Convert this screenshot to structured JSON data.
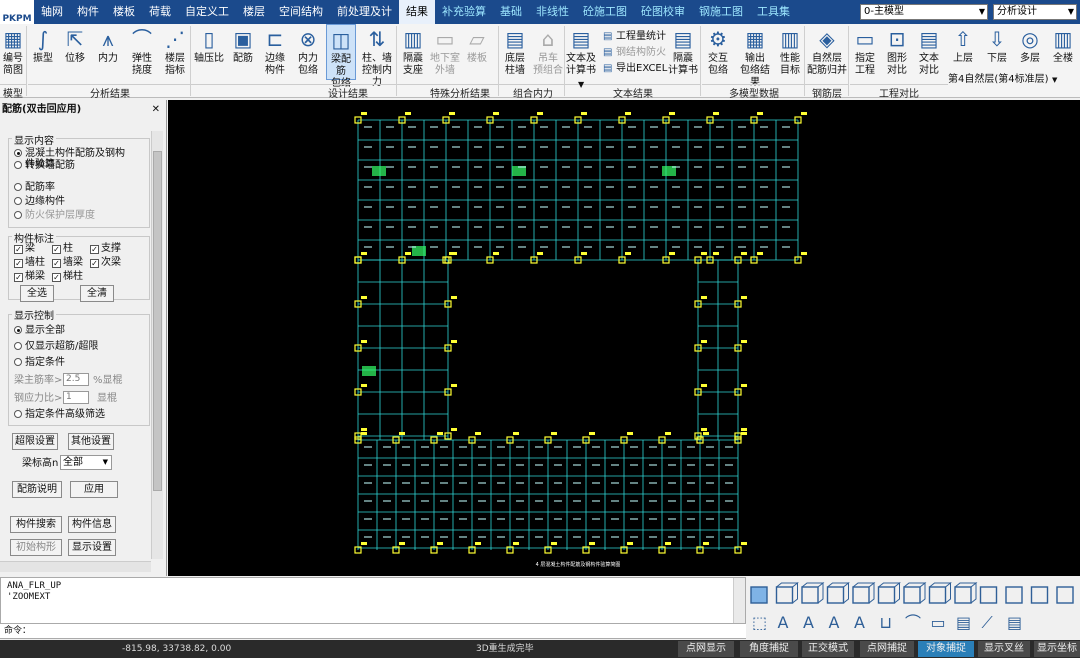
{
  "app": {
    "logo_text": "PKPM"
  },
  "menu": {
    "tabs": [
      "轴网",
      "构件",
      "楼板",
      "荷载",
      "自定义工",
      "楼层",
      "空间结构",
      "前处理及计",
      "结果",
      "补充验算",
      "基础",
      "非线性",
      "砼施工图",
      "砼图校审",
      "钢施工图",
      "工具集"
    ],
    "active": "结果",
    "model_select": "0-主模型",
    "mode_select": "分析设计"
  },
  "ribbon": {
    "buttons": [
      {
        "id": "numbering",
        "label": "编号\n简图"
      },
      {
        "id": "vibration",
        "label": "振型"
      },
      {
        "id": "displacement",
        "label": "位移"
      },
      {
        "id": "internal_force",
        "label": "内力"
      },
      {
        "id": "elastic_deflection",
        "label": "弹性\n挠度"
      },
      {
        "id": "floor_index",
        "label": "楼层\n指标"
      },
      {
        "id": "axial_ratio",
        "label": "轴压比"
      },
      {
        "id": "reinforcement",
        "label": "配筋"
      },
      {
        "id": "edge_member",
        "label": "边缘\n构件"
      },
      {
        "id": "force_envelope",
        "label": "内力\n包络"
      },
      {
        "id": "beam_envelope",
        "label": "梁配筋\n包络"
      },
      {
        "id": "column_wall_control",
        "label": "柱、墙\n控制内力"
      },
      {
        "id": "isolation_support",
        "label": "隔震\n支座"
      },
      {
        "id": "basement_wall",
        "label": "地下室\n外墙"
      },
      {
        "id": "floor_slab",
        "label": "楼板"
      },
      {
        "id": "bottom_column_wall",
        "label": "底层\n柱墙"
      },
      {
        "id": "crane_combination",
        "label": "吊车\n预组合"
      },
      {
        "id": "text_calc",
        "label": "文本及\n计算书"
      },
      {
        "id": "isolation_calc",
        "label": "隔震\n计算书"
      },
      {
        "id": "interaction_envelope",
        "label": "交互\n包络"
      },
      {
        "id": "output_envelope",
        "label": "输出\n包络结果"
      },
      {
        "id": "performance_target",
        "label": "性能\n目标"
      },
      {
        "id": "natural_floor_rebar",
        "label": "自然层\n配筋归并"
      },
      {
        "id": "specify_project",
        "label": "指定\n工程"
      },
      {
        "id": "graphic_compare",
        "label": "图形\n对比"
      },
      {
        "id": "text_compare",
        "label": "文本\n对比"
      },
      {
        "id": "upper_floor",
        "label": "上层"
      },
      {
        "id": "lower_floor",
        "label": "下层"
      },
      {
        "id": "multi_floor",
        "label": "多层"
      },
      {
        "id": "all_floors",
        "label": "全楼"
      }
    ],
    "small_buttons": {
      "quantity_stats": "工程量统计",
      "steel_fireproof": "钢结构防火",
      "export_excel": "导出EXCEL"
    },
    "groups": [
      "模型",
      "分析结果",
      "设计结果",
      "特殊分析结果",
      "组合内力",
      "文本结果",
      "多模型数据",
      "钢筋层",
      "工程对比"
    ],
    "floor_select": "第4自然层(第4标准层)"
  },
  "panel": {
    "title": "配筋(双击回应用)",
    "display_content": {
      "title": "显示内容",
      "options": [
        "混凝土构件配筋及钢构件验算",
        "转换墙配筋",
        "配筋率",
        "边缘构件",
        "防火保护层厚度"
      ],
      "selected": 0
    },
    "member_label": {
      "title": "构件标注",
      "items": [
        {
          "label": "梁",
          "checked": true
        },
        {
          "label": "柱",
          "checked": true
        },
        {
          "label": "支撑",
          "checked": true
        },
        {
          "label": "墙柱",
          "checked": true
        },
        {
          "label": "墙梁",
          "checked": true
        },
        {
          "label": "次梁",
          "checked": true
        },
        {
          "label": "梯梁",
          "checked": true
        },
        {
          "label": "梯柱",
          "checked": true
        }
      ],
      "select_all": "全选",
      "clear_all": "全清"
    },
    "display_control": {
      "title": "显示控制",
      "options": [
        "显示全部",
        "仅显示超筋/超限",
        "指定条件",
        "指定条件高级筛选"
      ],
      "selected": 0,
      "beam_ratio_label": "梁主筋率>",
      "beam_ratio_value": "2.5",
      "beam_ratio_unit": "%显棍",
      "steel_stress_label": "钢应力比>",
      "steel_stress_value": "1",
      "steel_stress_unit": "显棍"
    },
    "buttons": {
      "over_limit": "超限设置",
      "other_settings": "其他设置",
      "rebar_note": "配筋说明",
      "apply": "应用",
      "member_search": "构件搜索",
      "member_info": "构件信息",
      "initial_shape": "初始构形",
      "display_settings": "显示设置"
    },
    "beam_height_label": "梁标高n",
    "beam_height_value": "全部"
  },
  "command": {
    "history": [
      "ANA_FLR_UP",
      "'ZOOMEXT"
    ],
    "prompt": "命令："
  },
  "status": {
    "coords": "-815.98, 33738.82, 0.00",
    "message": "3D重生成完毕",
    "toggles": [
      {
        "label": "点网显示",
        "on": false
      },
      {
        "label": "角度捕捉",
        "on": false
      },
      {
        "label": "正交模式",
        "on": false
      },
      {
        "label": "点网捕捉",
        "on": false
      },
      {
        "label": "对象捕捉",
        "on": true
      },
      {
        "label": "显示叉丝",
        "on": false
      },
      {
        "label": "显示坐标",
        "on": false
      }
    ]
  },
  "colors": {
    "menubar": "#1b4a8c",
    "canvas_bg": "#000000",
    "grid_line": "#2fd6d6",
    "label_yellow": "#ffff33",
    "label_green": "#33ff66",
    "status_on": "#2a7fb8"
  },
  "canvas_caption": "4 层混凝土构件配筋及钢构件验算简图"
}
